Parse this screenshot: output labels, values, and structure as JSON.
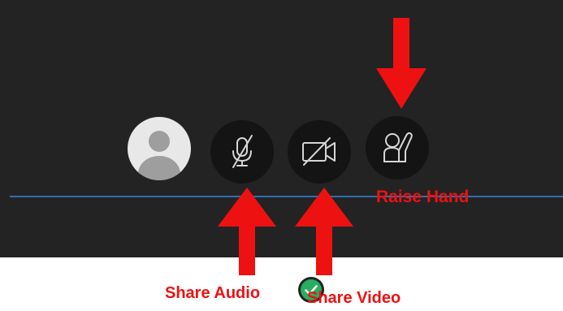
{
  "controls": {
    "audio": {
      "icon": "microphone-muted-icon"
    },
    "video": {
      "icon": "camera-off-icon"
    },
    "raise_hand": {
      "icon": "raise-hand-icon"
    },
    "avatar": {
      "icon": "user-avatar-icon",
      "status": "available-check-icon"
    }
  },
  "annotations": {
    "raise_hand_label": "Raise Hand",
    "share_audio_label": "Share Audio",
    "share_video_label": "Share Video"
  },
  "colors": {
    "background": "#232323",
    "button": "#141414",
    "accent_line": "#2f6fb3",
    "status_green": "#27ae60",
    "annotation_red": "#ee1111"
  }
}
